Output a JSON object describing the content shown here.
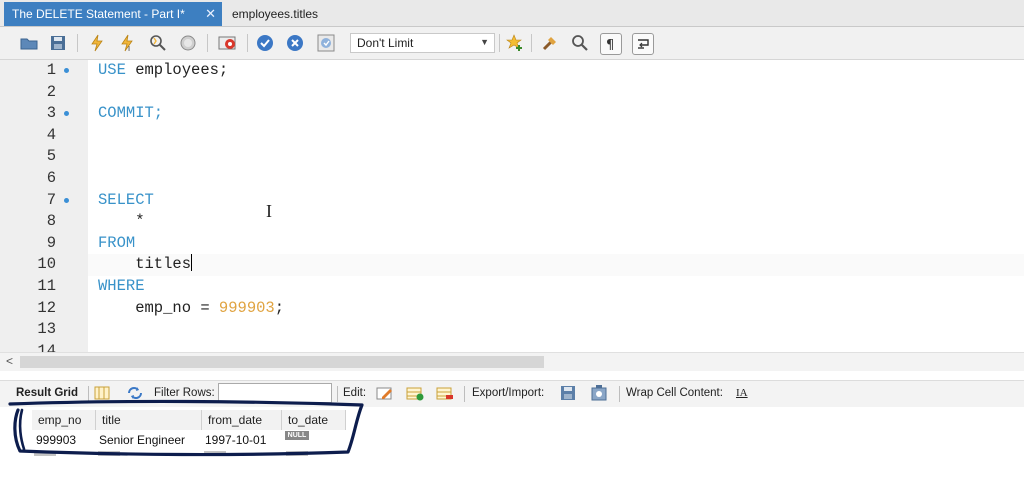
{
  "tabs": [
    {
      "label": "The DELETE Statement - Part I*",
      "active": true
    },
    {
      "label": "employees.titles",
      "active": false
    }
  ],
  "toolbar": {
    "limit_label": "Don't Limit",
    "icons": [
      "open-folder-icon",
      "save-icon",
      "execute-icon",
      "execute-current-icon",
      "explain-icon",
      "stop-icon",
      "toggle-stop-on-error-icon",
      "commit-icon",
      "rollback-icon",
      "autocommit-icon",
      "bookmark-star-icon",
      "beautify-icon",
      "find-icon",
      "invisible-chars-icon",
      "word-wrap-icon"
    ]
  },
  "editor": {
    "lines": [
      {
        "n": "1",
        "dot": true
      },
      {
        "n": "2",
        "dot": false
      },
      {
        "n": "3",
        "dot": true
      },
      {
        "n": "4",
        "dot": false
      },
      {
        "n": "5",
        "dot": false
      },
      {
        "n": "6",
        "dot": false
      },
      {
        "n": "7",
        "dot": true
      },
      {
        "n": "8",
        "dot": false
      },
      {
        "n": "9",
        "dot": false
      },
      {
        "n": "10",
        "dot": false
      },
      {
        "n": "11",
        "dot": false
      },
      {
        "n": "12",
        "dot": false
      },
      {
        "n": "13",
        "dot": false
      },
      {
        "n": "14",
        "dot": false
      }
    ],
    "code": {
      "l1_kw": "USE",
      "l1_rest": " employees;",
      "l3_kw": "COMMIT;",
      "l7_kw": "SELECT",
      "l8": "    *",
      "l9_kw": "FROM",
      "l10": "    titles",
      "l11_kw": "WHERE",
      "l12_a": "    emp_no = ",
      "l12_num": "999903",
      "l12_b": ";"
    }
  },
  "results_toolbar": {
    "result_grid": "Result Grid",
    "filter_rows": "Filter Rows:",
    "edit": "Edit:",
    "export_import": "Export/Import:",
    "wrap_cell": "Wrap Cell Content:",
    "wrap_icon_glyph": "IA"
  },
  "grid": {
    "columns": [
      "emp_no",
      "title",
      "from_date",
      "to_date"
    ],
    "rows": [
      {
        "emp_no": "999903",
        "title": "Senior Engineer",
        "from_date": "1997-10-01",
        "to_date": "NULL"
      }
    ]
  },
  "colors": {
    "keyword": "#3892c9",
    "number": "#e0a340",
    "tab_active": "#3d7fc1",
    "annotation_ink": "#0d1d4d"
  }
}
